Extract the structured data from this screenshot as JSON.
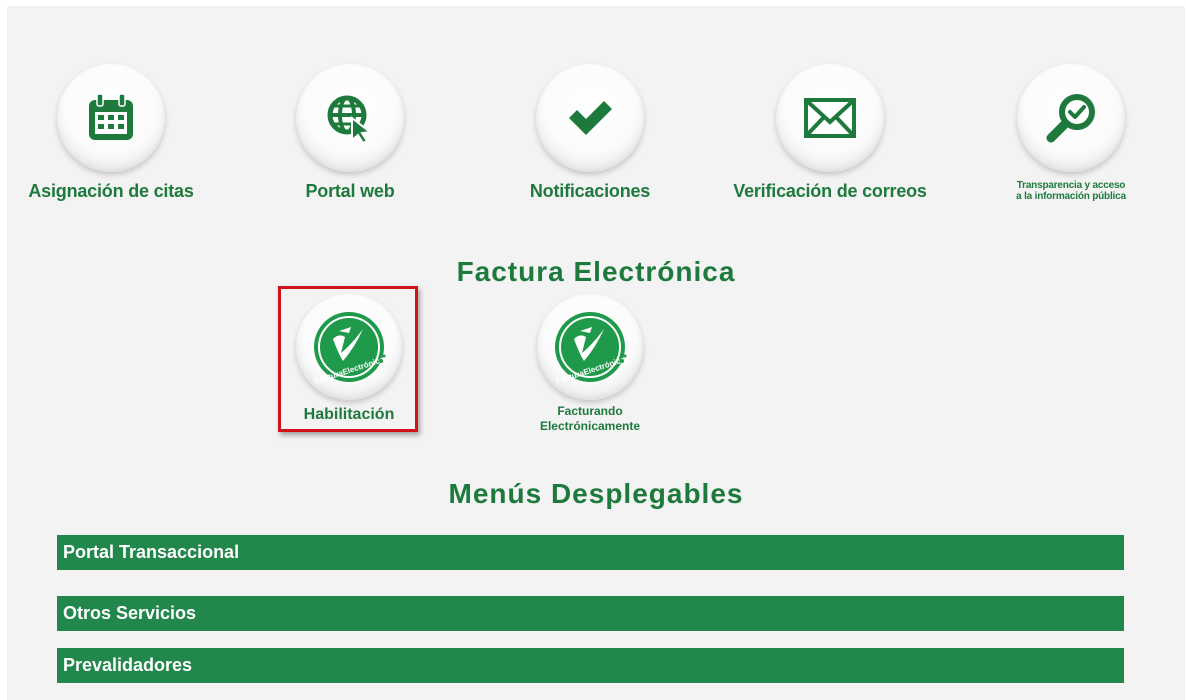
{
  "services": [
    {
      "label": "Asignación de citas",
      "icon": "calendar-icon"
    },
    {
      "label": "Portal web",
      "icon": "globe-cursor-icon"
    },
    {
      "label": "Notificaciones",
      "icon": "checkmark-icon"
    },
    {
      "label": "Verificación de correos",
      "icon": "envelope-icon"
    },
    {
      "label_line1": "Transparencia y acceso",
      "label_line2": "a la información pública",
      "icon": "magnifier-check-icon"
    }
  ],
  "factura": {
    "title": "Factura Electrónica",
    "items": [
      {
        "label": "Habilitación",
        "icon": "factura-electronica-logo-icon",
        "highlighted": true
      },
      {
        "label_line1": "Facturando",
        "label_line2": "Electrónicamente",
        "icon": "factura-electronica-logo-icon"
      }
    ],
    "logo_text_1": "Factura",
    "logo_text_2": "Electrónica"
  },
  "menus": {
    "title": "Menús Desplegables",
    "items": [
      {
        "label": "Portal Transaccional"
      },
      {
        "label": "Otros Servicios"
      },
      {
        "label": "Prevalidadores"
      }
    ]
  },
  "colors": {
    "brand_green": "#1e7a3c",
    "menu_green": "#21874a",
    "highlight_red": "#d0121b",
    "page_bg": "#f3f3f3"
  }
}
